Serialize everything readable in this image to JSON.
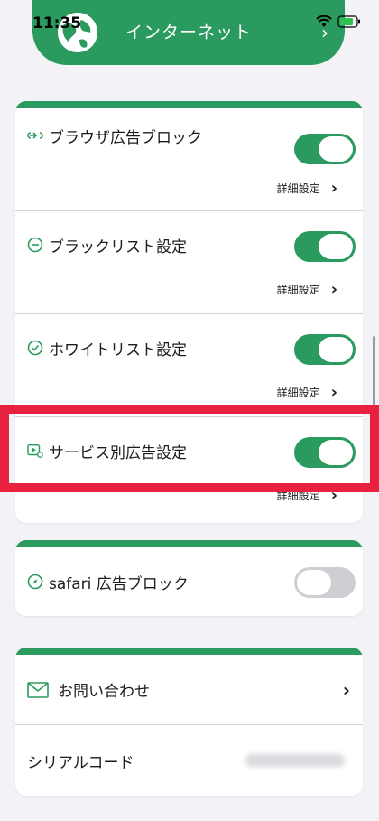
{
  "status_bar": {
    "time": "11:35"
  },
  "header": {
    "title": "インターネット"
  },
  "block_card": {
    "rows": [
      {
        "label": "ブラウザ広告ブロック",
        "toggle_on": true,
        "detail": "詳細設定"
      },
      {
        "label": "ブラックリスト設定",
        "toggle_on": true,
        "detail": "詳細設定"
      },
      {
        "label": "ホワイトリスト設定",
        "toggle_on": true,
        "detail": "詳細設定"
      },
      {
        "label": "サービス別広告設定",
        "toggle_on": true,
        "detail": "詳細設定"
      }
    ]
  },
  "safari_card": {
    "label": "safari 広告ブロック",
    "toggle_on": false
  },
  "info_card": {
    "contact_label": "お問い合わせ",
    "serial_label": "シリアルコード"
  },
  "colors": {
    "brand_green": "#2a9a5e",
    "highlight_red": "#e8213f"
  },
  "icons": [
    "globe-logo",
    "wifi-icon",
    "battery-icon",
    "link-icon",
    "minus-circle-icon",
    "check-circle-icon",
    "video-gear-icon",
    "compass-icon",
    "mail-icon",
    "chevron-right-icon"
  ]
}
